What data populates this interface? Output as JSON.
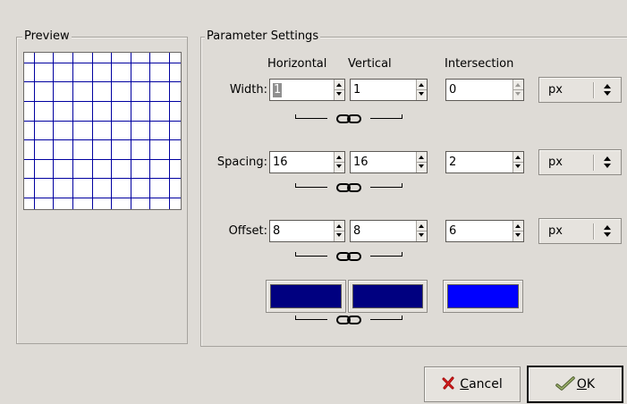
{
  "preview": {
    "title": "Preview",
    "grid_color": "#0000a0",
    "grid_background": "#ffffff"
  },
  "parameters": {
    "title": "Parameter Settings",
    "columns": {
      "horizontal": "Horizontal",
      "vertical": "Vertical",
      "intersection": "Intersection"
    },
    "rows": [
      {
        "label": "Width:",
        "horizontal": "1",
        "vertical": "1",
        "intersection": "0",
        "unit": "px"
      },
      {
        "label": "Spacing:",
        "horizontal": "16",
        "vertical": "16",
        "intersection": "2",
        "unit": "px"
      },
      {
        "label": "Offset:",
        "horizontal": "8",
        "vertical": "8",
        "intersection": "6",
        "unit": "px"
      }
    ],
    "colors": {
      "horizontal": "#000080",
      "vertical": "#000080",
      "intersection": "#0000ff"
    }
  },
  "buttons": {
    "cancel": {
      "mnemonic": "C",
      "rest": "ancel"
    },
    "ok": {
      "mnemonic": "O",
      "rest": "K"
    }
  }
}
